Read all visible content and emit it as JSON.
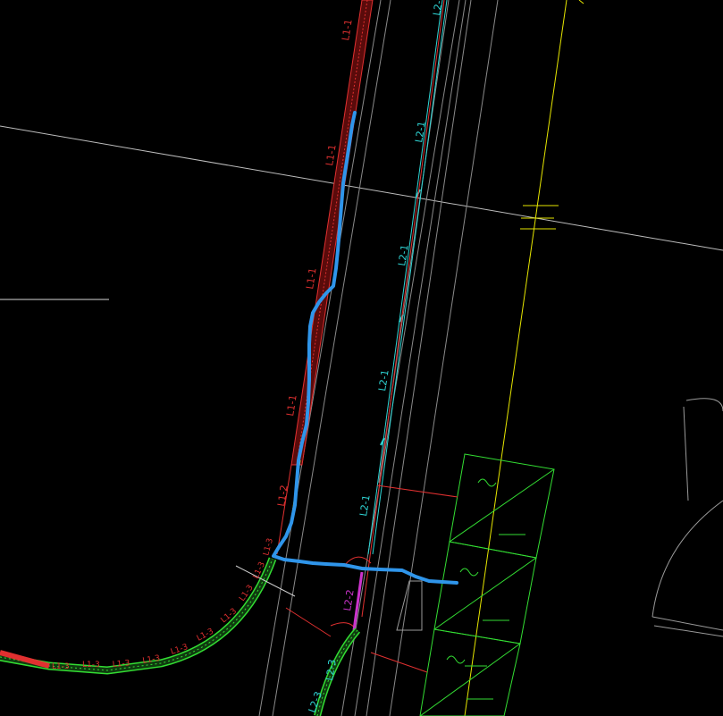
{
  "colors": {
    "background": "#000000",
    "road_line": "#9a9a9a",
    "red_line": "#e03030",
    "cyan_line": "#2fd6d6",
    "yellow_line": "#e6e600",
    "green_line": "#33dd33",
    "magenta_line": "#cc33cc",
    "blue_trace": "#2f95ea",
    "white_line": "#d8d8d8"
  },
  "labels": {
    "l1_1_a": "L1-1",
    "l1_1_b": "L1-1",
    "l1_1_c": "L1-1",
    "l1_1_d": "L1-1",
    "l1_2": "L1-2",
    "l2_1_top": "L2-1",
    "l2_1_a": "L2-1",
    "l2_1_b": "L2-1",
    "l2_1_c": "L2-1",
    "l2_1_d": "L2-1",
    "l2_2": "L2-2",
    "l2_3_a": "L2-3",
    "l2_3_b": "L2-3",
    "l1_3_1": "L1-3",
    "l1_3_2": "L1-3",
    "l1_3_3": "L1-3",
    "l1_3_4": "L1-3",
    "l1_3_5": "L1-3",
    "l1_3_6": "L1-3",
    "l1_3_7": "L1-3",
    "l1_3_8": "L1-3",
    "l1_3_9": "L1-3",
    "l1_3_10": "L1-3"
  }
}
